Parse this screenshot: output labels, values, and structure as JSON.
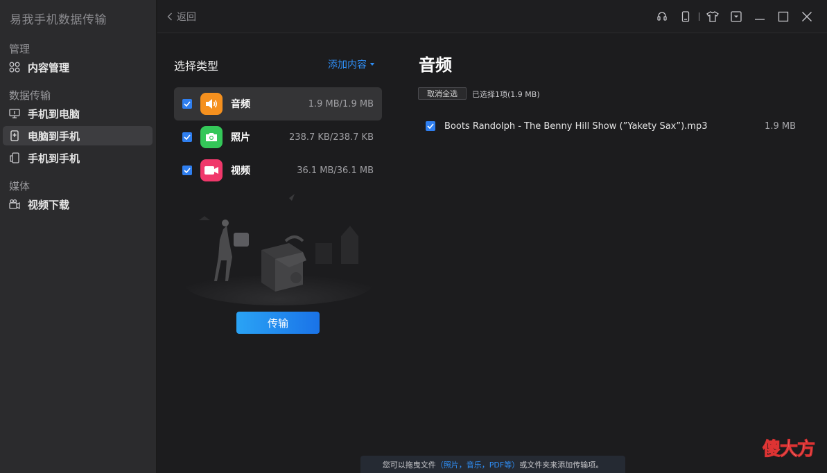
{
  "app": {
    "title": "易我手机数据传输"
  },
  "sidebar": {
    "sections": [
      {
        "label": "管理",
        "items": [
          {
            "label": "内容管理",
            "icon": "grid-icon"
          }
        ]
      },
      {
        "label": "数据传输",
        "items": [
          {
            "label": "手机到电脑",
            "icon": "monitor-icon"
          },
          {
            "label": "电脑到手机",
            "icon": "phone-icon",
            "active": true
          },
          {
            "label": "手机到手机",
            "icon": "phones-icon"
          }
        ]
      },
      {
        "label": "媒体",
        "items": [
          {
            "label": "视频下载",
            "icon": "video-download-icon"
          }
        ]
      }
    ]
  },
  "topbar": {
    "back_label": "返回"
  },
  "mid": {
    "select_type_label": "选择类型",
    "add_content_label": "添加内容",
    "types": [
      {
        "name": "音频",
        "size": "1.9 MB/1.9 MB",
        "icon": "audio-icon",
        "color": "#f5901e",
        "checked": true
      },
      {
        "name": "照片",
        "size": "238.7 KB/238.7 KB",
        "icon": "camera-icon",
        "color": "#34c759",
        "checked": true
      },
      {
        "name": "视频",
        "size": "36.1 MB/36.1 MB",
        "icon": "video-icon",
        "color": "#f0386b",
        "checked": true
      }
    ],
    "transfer_label": "传输"
  },
  "right": {
    "title": "音频",
    "deselect_label": "取消全选",
    "selected_info": "已选择1项(1.9 MB)",
    "files": [
      {
        "name": "Boots Randolph - The Benny Hill Show (”Yakety Sax”).mp3",
        "size": "1.9 MB",
        "checked": true
      }
    ]
  },
  "hint": {
    "prefix": "您可以拖曳文件",
    "highlight": "（照片，音乐，PDF等）",
    "suffix": "或文件夹来添加传输项。"
  },
  "watermark": {
    "text": "傻大方"
  },
  "colors": {
    "accent": "#2f8ef5",
    "sidebar_bg": "#2b2b2d",
    "main_bg": "#1c1c1e"
  }
}
